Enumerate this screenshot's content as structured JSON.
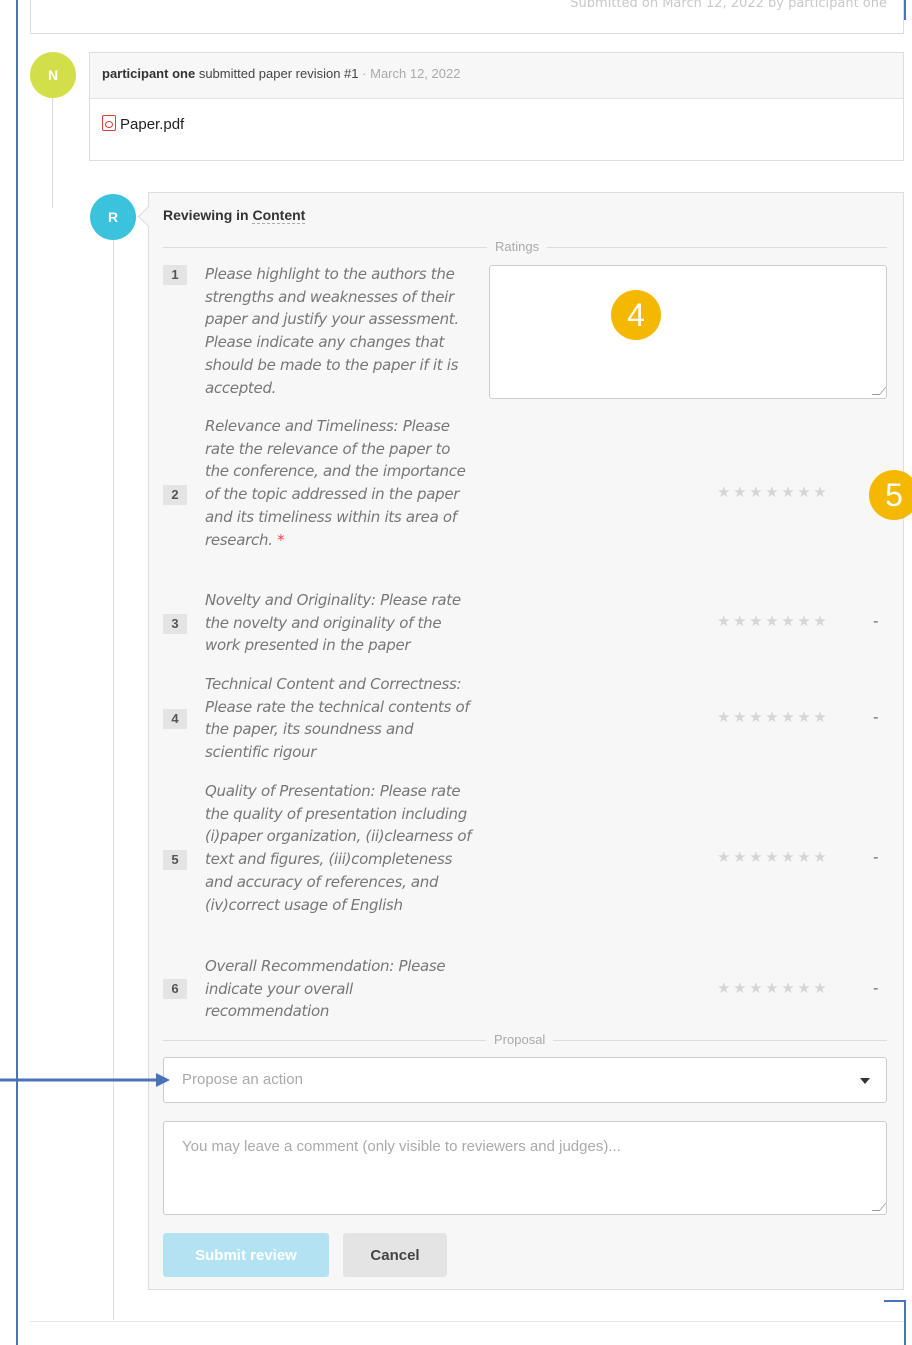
{
  "top_card": {
    "faded_text": "Submitted on March 12, 2022 by participant one"
  },
  "event": {
    "avatar_letter": "N",
    "who": "participant one",
    "action": "submitted paper revision #1",
    "separator": "·",
    "date": "March 12, 2022",
    "attachment": "Paper.pdf"
  },
  "review": {
    "avatar_letter": "R",
    "title_prefix": "Reviewing in",
    "title_context": "Content",
    "ratings_label": "Ratings",
    "proposal_label": "Proposal",
    "stars": "★★★★★★★",
    "questions": [
      {
        "num": "1",
        "text": "Please highlight to the authors the strengths and weaknesses of their paper and justify your assessment. Please indicate any changes that should be made to the paper if it is accepted."
      },
      {
        "num": "2",
        "text": "Relevance and Timeliness: Please rate the relevance of the paper to the conference, and the importance of the topic addressed in the paper and its timeliness within its area of research.",
        "required": "*"
      },
      {
        "num": "3",
        "text": "Novelty and Originality: Please rate the novelty and originality of the work presented in the paper",
        "dash": "-"
      },
      {
        "num": "4",
        "text": "Technical Content and Correctness: Please rate the technical contents of the paper, its soundness and scientific rigour",
        "dash": "-"
      },
      {
        "num": "5",
        "text": "Quality of Presentation: Please rate the quality of presentation including (i)paper organization, (ii)clearness of text and figures, (iii)completeness and accuracy of references, and (iv)correct usage of English",
        "dash": "-"
      },
      {
        "num": "6",
        "text": "Overall Recommendation: Please indicate your overall recommendation",
        "dash": "-"
      }
    ],
    "proposal_placeholder": "Propose an action",
    "comment_placeholder": "You may leave a comment (only visible to reviewers and judges)...",
    "submit_label": "Submit review",
    "cancel_label": "Cancel"
  },
  "annotations": {
    "badge_4": "4",
    "badge_5": "5"
  },
  "colors": {
    "accent_badge": "#f5b800",
    "avatar_n": "#d2de4a",
    "avatar_r": "#3bc3de",
    "arrow": "#4a72b8"
  }
}
